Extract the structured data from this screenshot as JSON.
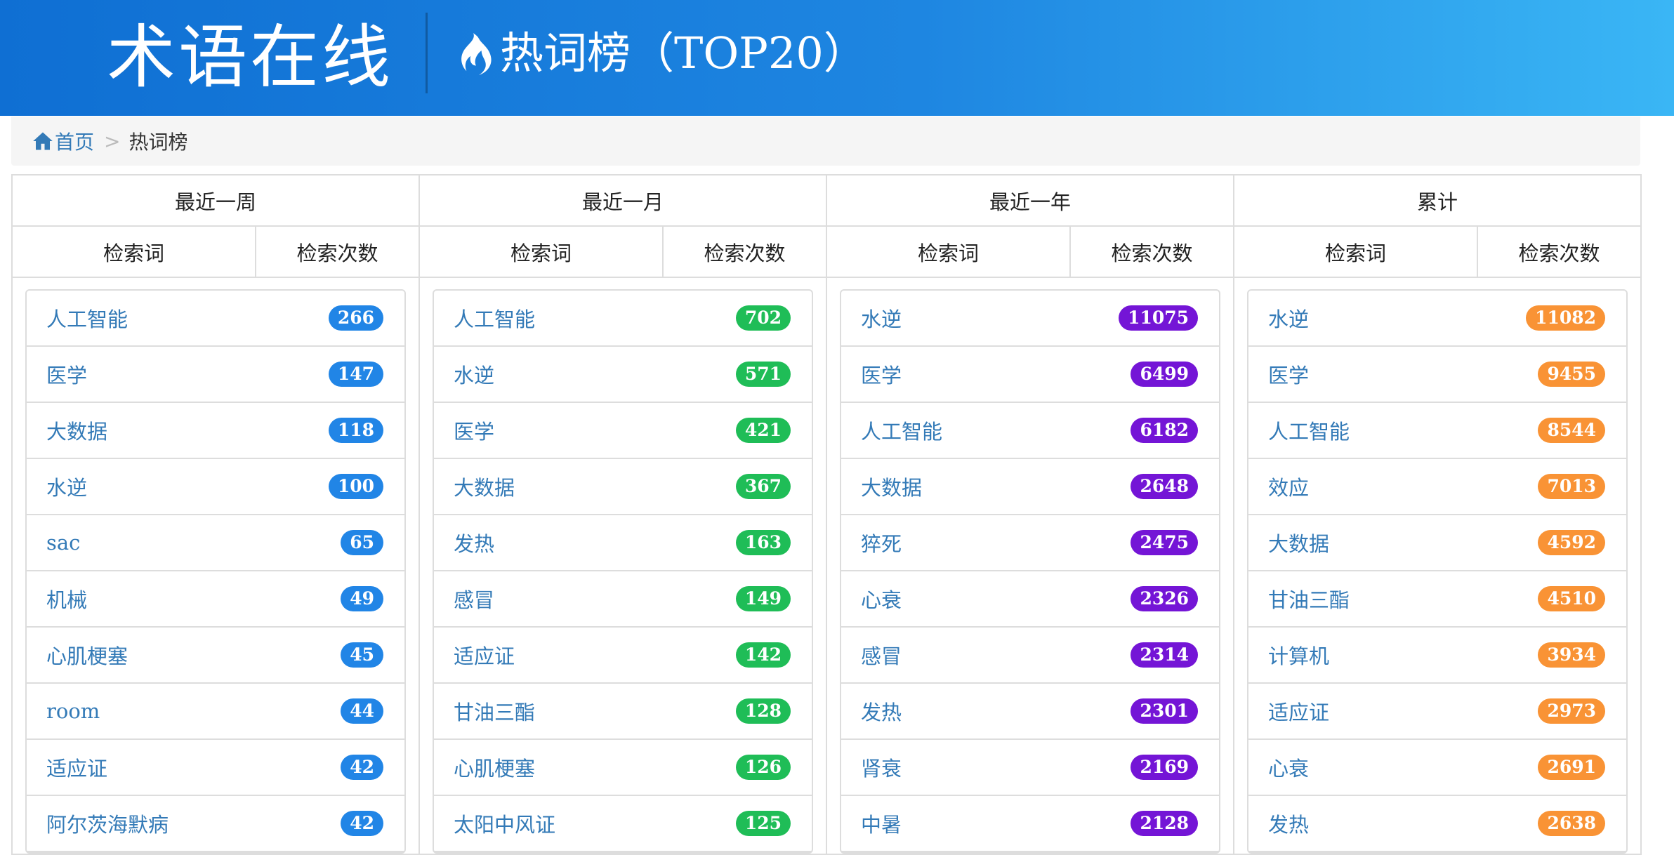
{
  "header": {
    "logo_text": "术语在线",
    "page_heading": "热词榜（TOP20）",
    "flame_icon": "flame-icon"
  },
  "breadcrumb": {
    "home_icon": "home-icon",
    "home_label": "首页",
    "separator": ">",
    "current": "热词榜"
  },
  "colors": {
    "week": "#2185e6",
    "month": "#1fbd57",
    "year": "#7415d6",
    "total": "#f99335"
  },
  "sub_headers": {
    "term": "检索词",
    "count": "检索次数"
  },
  "columns": [
    {
      "title": "最近一周",
      "items": [
        {
          "term": "人工智能",
          "count": "266"
        },
        {
          "term": "医学",
          "count": "147"
        },
        {
          "term": "大数据",
          "count": "118"
        },
        {
          "term": "水逆",
          "count": "100"
        },
        {
          "term": "sac",
          "count": "65"
        },
        {
          "term": "机械",
          "count": "49"
        },
        {
          "term": "心肌梗塞",
          "count": "45"
        },
        {
          "term": "room",
          "count": "44"
        },
        {
          "term": "适应证",
          "count": "42"
        },
        {
          "term": "阿尔茨海默病",
          "count": "42"
        }
      ]
    },
    {
      "title": "最近一月",
      "items": [
        {
          "term": "人工智能",
          "count": "702"
        },
        {
          "term": "水逆",
          "count": "571"
        },
        {
          "term": "医学",
          "count": "421"
        },
        {
          "term": "大数据",
          "count": "367"
        },
        {
          "term": "发热",
          "count": "163"
        },
        {
          "term": "感冒",
          "count": "149"
        },
        {
          "term": "适应证",
          "count": "142"
        },
        {
          "term": "甘油三酯",
          "count": "128"
        },
        {
          "term": "心肌梗塞",
          "count": "126"
        },
        {
          "term": "太阳中风证",
          "count": "125"
        }
      ]
    },
    {
      "title": "最近一年",
      "items": [
        {
          "term": "水逆",
          "count": "11075"
        },
        {
          "term": "医学",
          "count": "6499"
        },
        {
          "term": "人工智能",
          "count": "6182"
        },
        {
          "term": "大数据",
          "count": "2648"
        },
        {
          "term": "猝死",
          "count": "2475"
        },
        {
          "term": "心衰",
          "count": "2326"
        },
        {
          "term": "感冒",
          "count": "2314"
        },
        {
          "term": "发热",
          "count": "2301"
        },
        {
          "term": "肾衰",
          "count": "2169"
        },
        {
          "term": "中暑",
          "count": "2128"
        }
      ]
    },
    {
      "title": "累计",
      "items": [
        {
          "term": "水逆",
          "count": "11082"
        },
        {
          "term": "医学",
          "count": "9455"
        },
        {
          "term": "人工智能",
          "count": "8544"
        },
        {
          "term": "效应",
          "count": "7013"
        },
        {
          "term": "大数据",
          "count": "4592"
        },
        {
          "term": "甘油三酯",
          "count": "4510"
        },
        {
          "term": "计算机",
          "count": "3934"
        },
        {
          "term": "适应证",
          "count": "2973"
        },
        {
          "term": "心衰",
          "count": "2691"
        },
        {
          "term": "发热",
          "count": "2638"
        }
      ]
    }
  ]
}
